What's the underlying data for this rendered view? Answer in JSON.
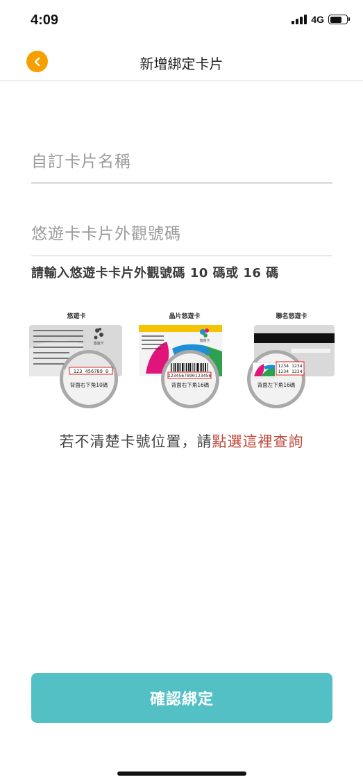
{
  "status_bar": {
    "time": "4:09",
    "network": "4G",
    "icons": [
      "signal-icon",
      "battery-icon"
    ]
  },
  "nav": {
    "back_icon": "chevron-left-icon",
    "title": "新增綁定卡片"
  },
  "form": {
    "card_name_placeholder": "自訂卡片名稱",
    "card_name_value": "",
    "card_number_placeholder": "悠遊卡卡片外觀號碼",
    "card_number_value": "",
    "hint": "請輸入悠遊卡卡片外觀號碼 10 碼或 16 碼"
  },
  "card_examples": [
    {
      "title": "悠遊卡",
      "number": "123 456789 0",
      "location": "背面右下角10碼",
      "logo_text": "悠遊卡"
    },
    {
      "title": "晶片悠遊卡",
      "number": "1234567890123456",
      "location": "背面右下角16碼",
      "logo_text": "悠遊卡"
    },
    {
      "title": "聯名悠遊卡",
      "number_line1": "1234 1234",
      "number_line2": "1234 1234",
      "location": "背面左下角16碼"
    }
  ],
  "help": {
    "text": "若不清楚卡號位置，請",
    "link": "點選這裡查詢"
  },
  "confirm_label": "確認綁定",
  "colors": {
    "accent_orange": "#f5a000",
    "button_teal": "#52c0c5",
    "link_red": "#c0493b"
  }
}
